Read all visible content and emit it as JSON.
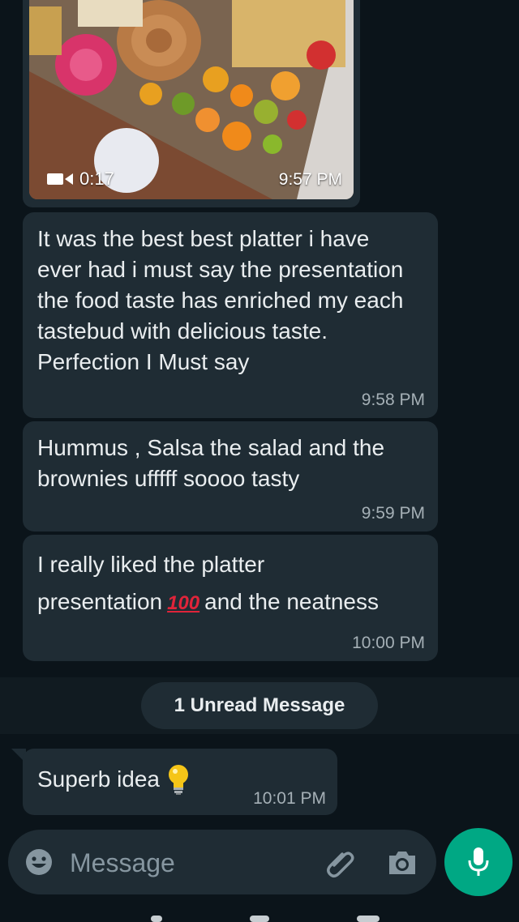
{
  "video_message": {
    "duration": "0:17",
    "time": "9:57 PM"
  },
  "messages": [
    {
      "text": "It was the best best platter i have ever had i must say the presentation the food taste has enriched my each tastebud with delicious taste. Perfection I Must say",
      "time": "9:58 PM"
    },
    {
      "text": "Hummus , Salsa the salad and the brownies ufffff soooo tasty",
      "time": "9:59 PM"
    },
    {
      "text_part1": "I really liked the platter presentation",
      "emoji": "100",
      "text_part2": "and the neatness",
      "time": "10:00 PM"
    }
  ],
  "unread_divider": "1 Unread Message",
  "latest_message": {
    "text": "Superb idea",
    "emoji": "light-bulb",
    "time": "10:01 PM"
  },
  "composer": {
    "placeholder": "Message"
  },
  "icons": {
    "video": "video-camera-icon",
    "emoji": "smiley-icon",
    "attach": "paperclip-icon",
    "camera": "camera-icon",
    "mic": "microphone-icon"
  },
  "colors": {
    "background": "#0b141a",
    "bubble": "#1f2c34",
    "accent": "#00a884"
  }
}
